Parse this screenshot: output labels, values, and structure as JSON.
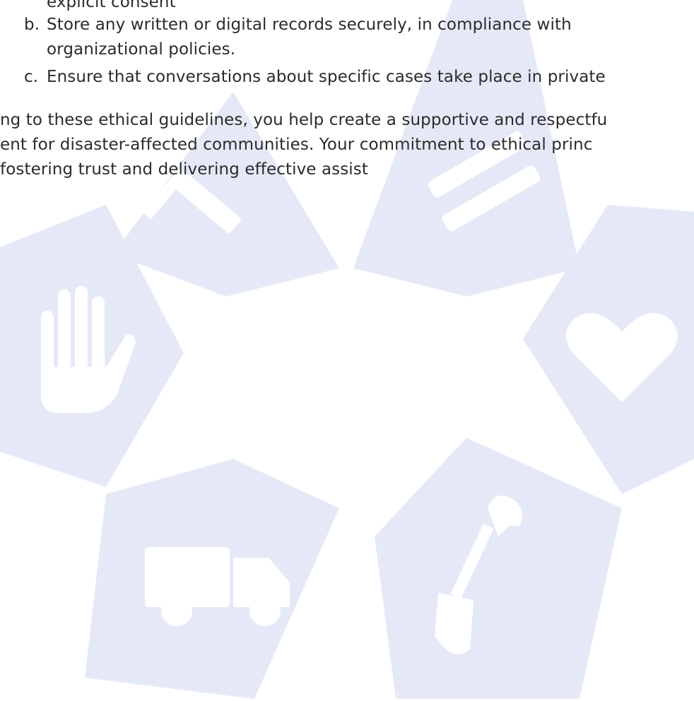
{
  "watermark": {
    "color": "#e5e9f7",
    "icons": [
      "hand-icon",
      "heart-icon",
      "truck-icon",
      "shovel-icon",
      "hammer-icon",
      "book-icon"
    ]
  },
  "list": {
    "item_a_tail": "explicit consent",
    "item_b": {
      "marker": "b.",
      "line1": "Store any written or digital records securely, in compliance with",
      "line2": "organizational policies."
    },
    "item_c": {
      "marker": "c.",
      "line1": "Ensure that conversations about specific cases take place in private"
    }
  },
  "paragraph": {
    "line1": "ng to these ethical guidelines, you help create a supportive and respectfu",
    "line2": "ent for disaster-affected communities. Your commitment to ethical princ",
    "line3": "fostering trust and delivering effective assist"
  }
}
